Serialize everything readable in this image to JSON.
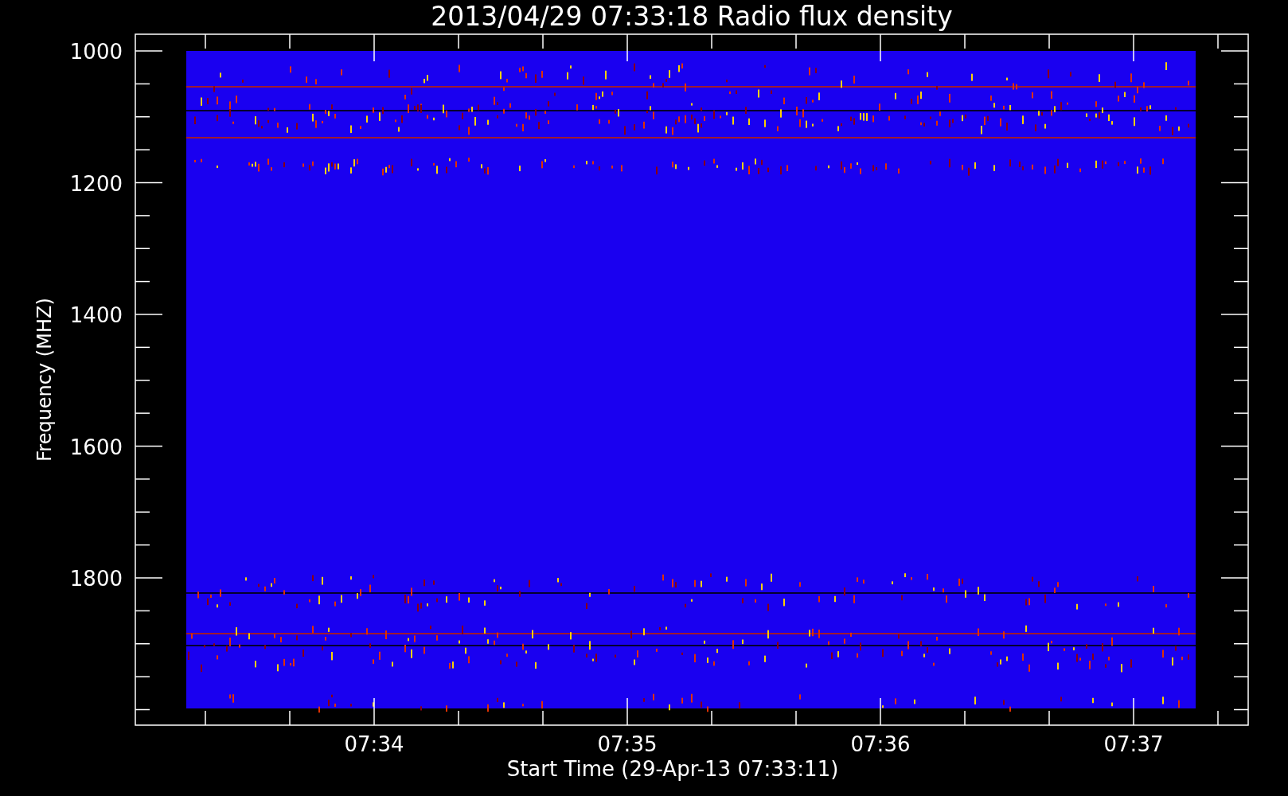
{
  "title": "2013/04/29 07:33:18 Radio flux density",
  "y_axis": {
    "label": "Frequency (MHZ)",
    "ticks": [
      "1000",
      "1200",
      "1400",
      "1600",
      "1800"
    ]
  },
  "x_axis": {
    "label": "Start Time (29-Apr-13 07:33:11)",
    "ticks": [
      "07:34",
      "07:35",
      "07:36",
      "07:37"
    ]
  }
}
